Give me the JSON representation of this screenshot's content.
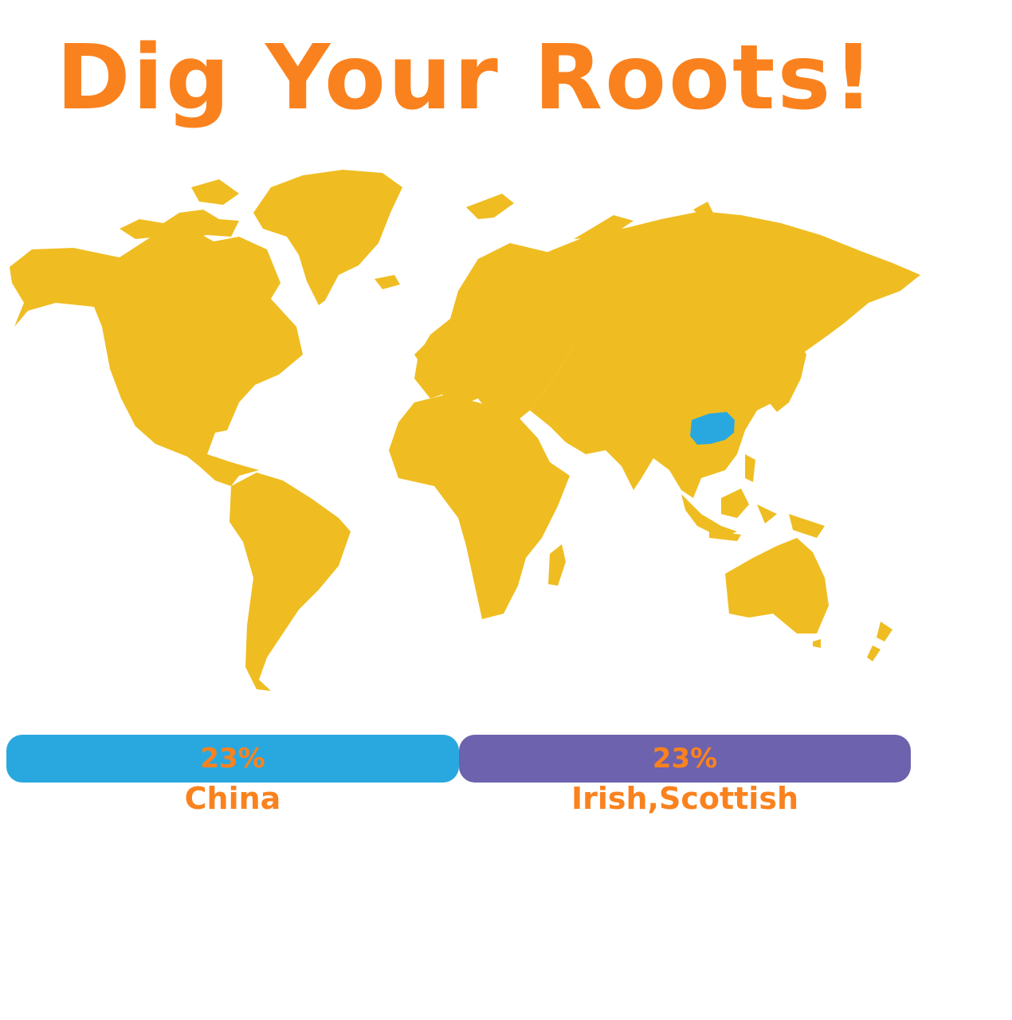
{
  "title": "Dig Your Roots!",
  "colors": {
    "accent": "#fa821e",
    "land": "#efbd22",
    "highlight": "#29a8e0",
    "bar_left": "#29a8e0",
    "bar_right": "#6d62ad"
  },
  "map": {
    "highlighted_region": "China"
  },
  "breakdown": [
    {
      "percent_label": "23%",
      "region": "China",
      "percent": 23
    },
    {
      "percent_label": "23%",
      "region": "Irish,Scottish",
      "percent": 23
    }
  ]
}
